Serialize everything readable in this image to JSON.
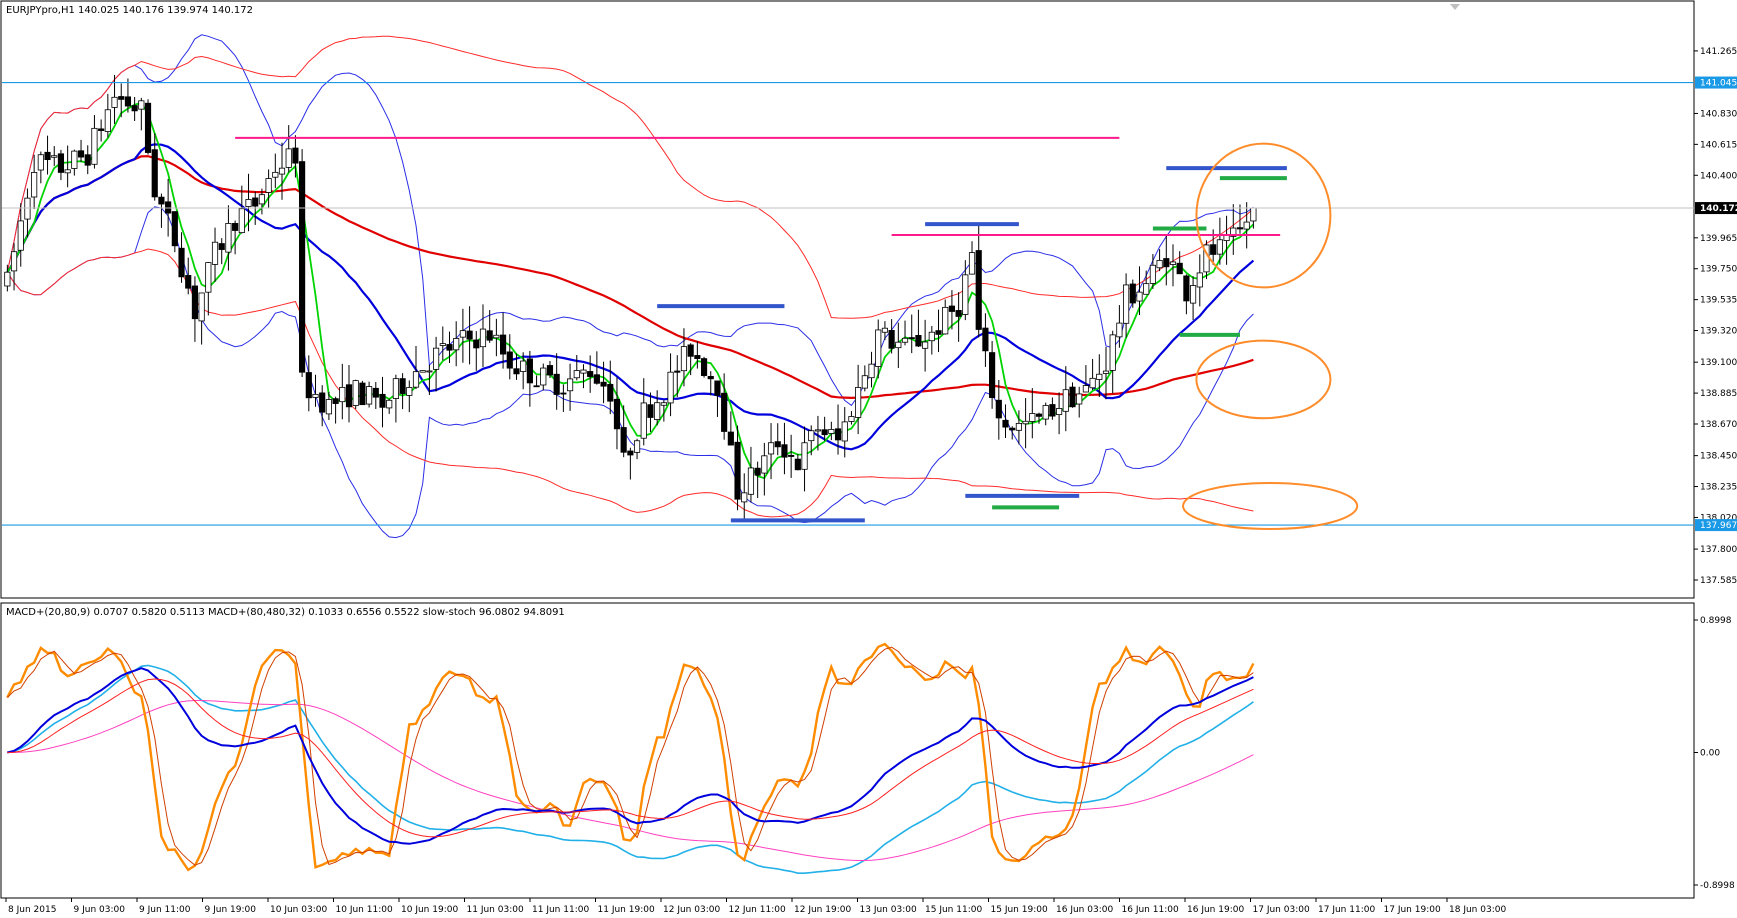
{
  "window": {
    "main_title": "EURJPYpro,H1  140.025 140.176 139.974 140.172",
    "sub_title": "MACD+(20,80,9) 0.0707 0.5820 0.5113  MACD+(80,480,32) 0.1033 0.6556 0.5522  slow-stoch 96.0802 94.8091"
  },
  "colors": {
    "candle": "#000000",
    "bb_inner": "#2a2ee6",
    "bb_outer": "#ff2a2a",
    "ma_fast": "#00d400",
    "ma_mid": "#0000dd",
    "ma_slow": "#e00000",
    "resistance_pink": "#ff1a8c",
    "levels_blue": "#3355cc",
    "levels_green": "#22aa44",
    "hline": "#1a9ae6",
    "circle": "#ff8c2a",
    "macd_fast": "#0000dd",
    "macd_fast_signal": "#ff2020",
    "macd_slow": "#22b0e8",
    "macd_slow_signal": "#ff40c0",
    "stoch_main": "#ff8c00",
    "stoch_signal": "#d04000"
  },
  "chart_data": {
    "type": "candlestick",
    "symbol": "EURJPYpro",
    "timeframe": "H1",
    "ylim": [
      137.585,
      141.48
    ],
    "y_ticks": [
      "141.265",
      "140.830",
      "140.615",
      "140.400",
      "139.965",
      "139.750",
      "139.535",
      "139.320",
      "139.100",
      "138.885",
      "138.670",
      "138.450",
      "138.235",
      "138.020",
      "137.800",
      "137.585"
    ],
    "y_tick_values": [
      141.265,
      140.83,
      140.615,
      140.4,
      139.965,
      139.75,
      139.535,
      139.32,
      139.1,
      138.885,
      138.67,
      138.45,
      138.235,
      138.02,
      137.8,
      137.585
    ],
    "x_ticks": [
      "8 Jun 2015",
      "9 Jun 03:00",
      "9 Jun 11:00",
      "9 Jun 19:00",
      "10 Jun 03:00",
      "10 Jun 11:00",
      "10 Jun 19:00",
      "11 Jun 03:00",
      "11 Jun 11:00",
      "11 Jun 19:00",
      "12 Jun 03:00",
      "12 Jun 11:00",
      "12 Jun 19:00",
      "13 Jun 03:00",
      "15 Jun 11:00",
      "15 Jun 19:00",
      "16 Jun 03:00",
      "16 Jun 11:00",
      "16 Jun 19:00",
      "17 Jun 03:00",
      "17 Jun 11:00",
      "17 Jun 19:00",
      "18 Jun 03:00"
    ],
    "bar_count": 216,
    "horizontal_lines": [
      {
        "price": 141.045,
        "label": "141.045"
      },
      {
        "price": 137.967,
        "label": "137.967"
      }
    ],
    "current_price": {
      "price": 140.172,
      "label": "140.172"
    },
    "resistance_lines": [
      {
        "price": 140.66,
        "from_bar": 34,
        "to_bar": 166
      },
      {
        "price": 139.985,
        "from_bar": 132,
        "to_bar": 190
      }
    ],
    "blue_levels": [
      {
        "price": 139.49,
        "from_bar": 97,
        "to_bar": 116
      },
      {
        "price": 140.06,
        "from_bar": 137,
        "to_bar": 151
      },
      {
        "price": 138.0,
        "from_bar": 108,
        "to_bar": 128
      },
      {
        "price": 138.17,
        "from_bar": 143,
        "to_bar": 160
      },
      {
        "price": 140.45,
        "from_bar": 173,
        "to_bar": 191
      }
    ],
    "green_levels": [
      {
        "price": 138.09,
        "from_bar": 147,
        "to_bar": 157
      },
      {
        "price": 140.03,
        "from_bar": 171,
        "to_bar": 179
      },
      {
        "price": 139.29,
        "from_bar": 175,
        "to_bar": 184
      },
      {
        "price": 140.38,
        "from_bar": 181,
        "to_bar": 191
      }
    ],
    "circles": [
      {
        "bar": 187.5,
        "price": 140.12,
        "rx_bars": 10,
        "ry_price": 0.5
      },
      {
        "bar": 187.5,
        "price": 138.98,
        "rx_bars": 10,
        "ry_price": 0.27
      },
      {
        "bar": 188.5,
        "price": 138.1,
        "rx_bars": 13,
        "ry_price": 0.16
      }
    ],
    "price_path": [
      [
        0,
        139.65
      ],
      [
        4,
        140.5
      ],
      [
        8,
        140.45
      ],
      [
        12,
        140.55
      ],
      [
        16,
        140.95
      ],
      [
        20,
        140.85
      ],
      [
        22,
        140.3
      ],
      [
        25,
        139.95
      ],
      [
        28,
        139.45
      ],
      [
        31,
        139.85
      ],
      [
        34,
        140.1
      ],
      [
        37,
        140.2
      ],
      [
        40,
        140.45
      ],
      [
        43,
        140.55
      ],
      [
        44,
        138.95
      ],
      [
        48,
        138.8
      ],
      [
        52,
        138.9
      ],
      [
        56,
        138.8
      ],
      [
        60,
        139.0
      ],
      [
        64,
        139.15
      ],
      [
        68,
        139.25
      ],
      [
        72,
        139.3
      ],
      [
        75,
        139.1
      ],
      [
        79,
        139.0
      ],
      [
        83,
        138.95
      ],
      [
        87,
        139.05
      ],
      [
        90,
        138.9
      ],
      [
        92,
        138.4
      ],
      [
        95,
        138.75
      ],
      [
        98,
        138.9
      ],
      [
        102,
        139.2
      ],
      [
        106,
        138.95
      ],
      [
        109,
        138.2
      ],
      [
        112,
        138.35
      ],
      [
        115,
        138.55
      ],
      [
        118,
        138.4
      ],
      [
        121,
        138.65
      ],
      [
        124,
        138.55
      ],
      [
        127,
        138.9
      ],
      [
        130,
        139.3
      ],
      [
        134,
        139.2
      ],
      [
        138,
        139.3
      ],
      [
        142,
        139.5
      ],
      [
        144,
        139.85
      ],
      [
        145,
        139.3
      ],
      [
        148,
        138.7
      ],
      [
        151,
        138.65
      ],
      [
        154,
        138.7
      ],
      [
        158,
        138.85
      ],
      [
        161,
        138.9
      ],
      [
        164,
        139.1
      ],
      [
        167,
        139.55
      ],
      [
        170,
        139.65
      ],
      [
        173,
        139.85
      ],
      [
        176,
        139.6
      ],
      [
        179,
        139.85
      ],
      [
        182,
        139.9
      ],
      [
        184,
        140.0
      ],
      [
        186,
        140.17
      ]
    ],
    "macd_pane": {
      "ylim": [
        -0.8998,
        0.8998
      ],
      "y_ticks": [
        "0.8998",
        "0.00",
        "-0.8998"
      ],
      "y_tick_values": [
        0.8998,
        0.0,
        -0.8998
      ]
    }
  }
}
